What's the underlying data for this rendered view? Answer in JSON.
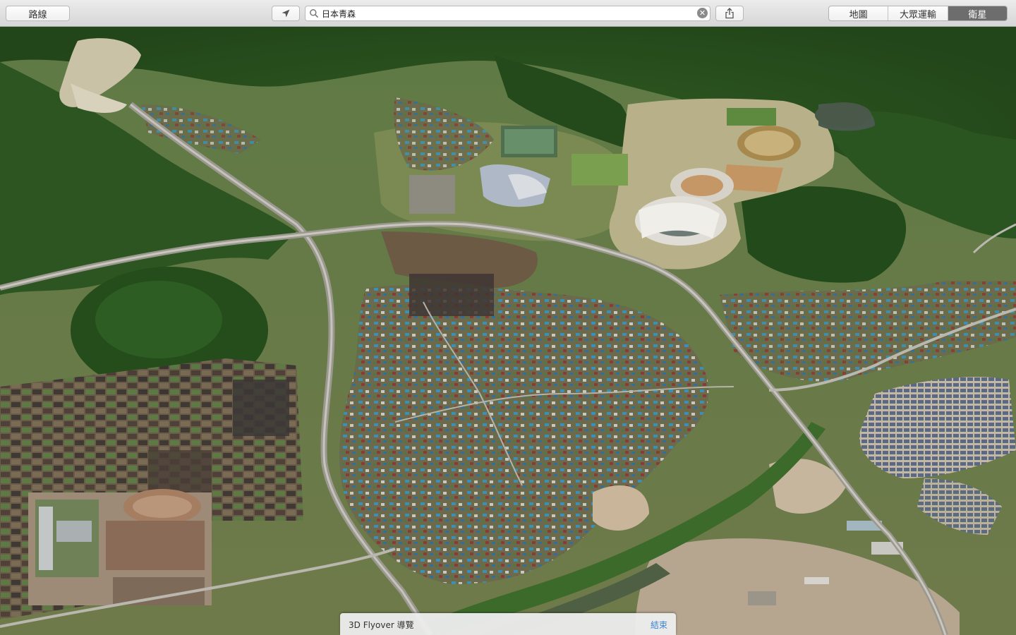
{
  "toolbar": {
    "directions_label": "路線",
    "locate_icon": "location-arrow-icon",
    "search": {
      "value": "日本青森",
      "icon": "magnifier-icon"
    },
    "share_icon": "share-icon",
    "map_modes": [
      "地圖",
      "大眾運輸",
      "衛星"
    ],
    "active_mode": "衛星"
  },
  "map": {
    "view": "satellite-3d-flyover"
  },
  "flyover": {
    "title": "3D Flyover 導覽",
    "end_label": "結束"
  },
  "colors": {
    "toolbar": "#e3e3e3",
    "active_segment": "#6d6d6d",
    "link": "#3a83d8"
  }
}
